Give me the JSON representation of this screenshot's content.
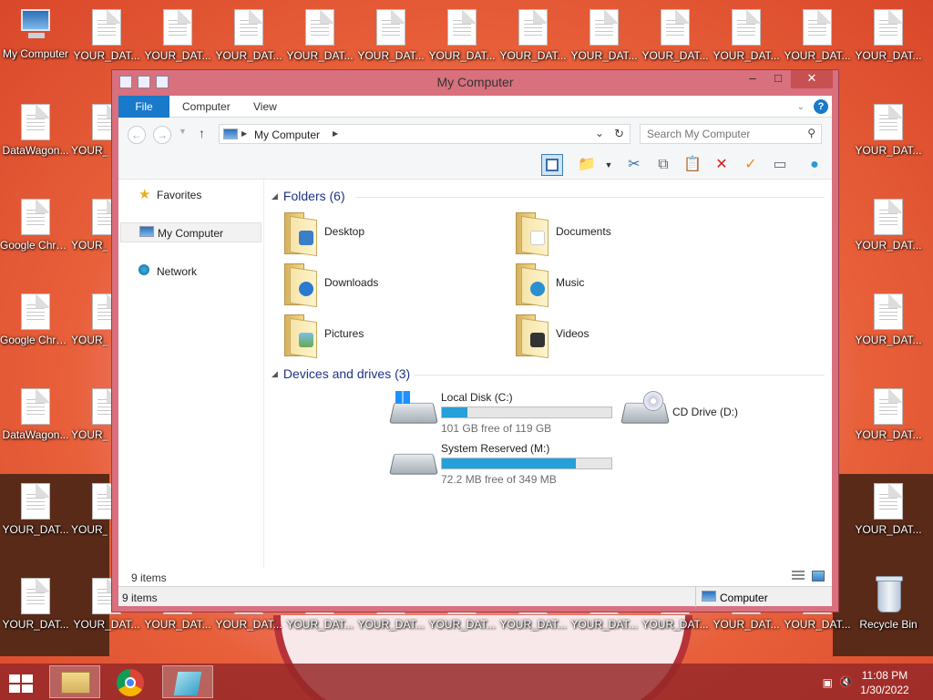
{
  "desktop": {
    "icons": [
      {
        "label": "My Computer"
      },
      {
        "label": "YOUR_DAT..."
      },
      {
        "label": "DataWagon..."
      },
      {
        "label": "Google Chrome.lnk..."
      },
      {
        "label": "YOUR_I"
      },
      {
        "label": "Recycle Bin"
      },
      {
        "label": "Y"
      }
    ]
  },
  "window": {
    "title": "My Computer",
    "controls": {
      "minimize": "–",
      "maximize": "□",
      "close": "✕"
    }
  },
  "ribbon": {
    "tabs": [
      "File",
      "Computer",
      "View"
    ],
    "help": "?"
  },
  "address": {
    "back": "←",
    "forward": "→",
    "up": "↑",
    "path": "My Computer",
    "search_placeholder": "Search My Computer"
  },
  "nav": {
    "items": [
      {
        "label": "Favorites"
      },
      {
        "label": "My Computer"
      },
      {
        "label": "Network"
      }
    ]
  },
  "content": {
    "folders_header": "Folders (6)",
    "folders": [
      {
        "label": "Desktop"
      },
      {
        "label": "Documents"
      },
      {
        "label": "Downloads"
      },
      {
        "label": "Music"
      },
      {
        "label": "Pictures"
      },
      {
        "label": "Videos"
      }
    ],
    "drives_header": "Devices and drives (3)",
    "drives": [
      {
        "label": "Local Disk (C:)",
        "free": "101 GB free of 119 GB",
        "used_fraction": 0.15
      },
      {
        "label": "CD Drive (D:)"
      },
      {
        "label": "System Reserved (M:)",
        "free": "72.2 MB free of 349 MB",
        "used_fraction": 0.79
      }
    ]
  },
  "status": {
    "items_count": "9 items",
    "items_count_bar": "9 items",
    "zone": "Computer"
  },
  "taskbar": {
    "time": "11:08 PM",
    "date": "1/30/2022"
  }
}
